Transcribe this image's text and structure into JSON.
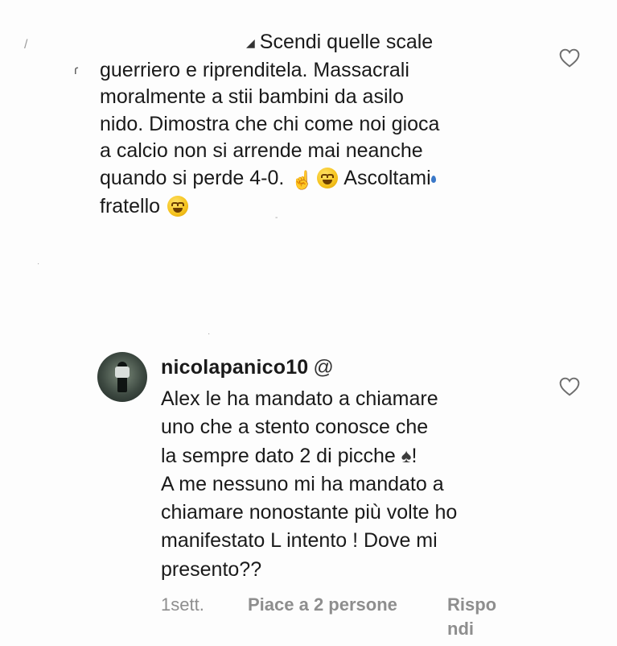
{
  "comment1": {
    "lines": [
      "Scendi quelle scale",
      "guerriero e riprenditela. Massacrali",
      "moralmente a stii bambini da asilo",
      "nido. Dimostra che chi come noi gioca",
      "a calcio non si arrende mai neanche",
      "quando si perde 4-0.",
      "Ascoltami",
      "fratello"
    ],
    "icons": [
      "heart-outline-icon",
      "raised-finger-emoji",
      "laughing-emoji",
      "smiling-emoji"
    ]
  },
  "comment2": {
    "username": "nicolapanico10",
    "lines": [
      "Alex le ha mandato a chiamare",
      "uno che a stento conosce che",
      "la sempre dato 2 di picche",
      "!",
      "A me nessuno mi ha mandato a",
      "chiamare nonostante più volte ho",
      "manifestato L intento ! Dove mi",
      "presento??"
    ],
    "icons": [
      "avatar",
      "mention-icon",
      "spade-suit-icon",
      "heart-outline-icon"
    ],
    "meta": {
      "time": "1sett.",
      "likes": "Piace a 2 persone",
      "reply_line1": "Rispo",
      "reply_line2": "ndi"
    }
  },
  "colors": {
    "background": "#fdfdfd",
    "text": "#1a1a1a",
    "meta": "#8e8e8e",
    "emoji": "#f5c21b"
  }
}
